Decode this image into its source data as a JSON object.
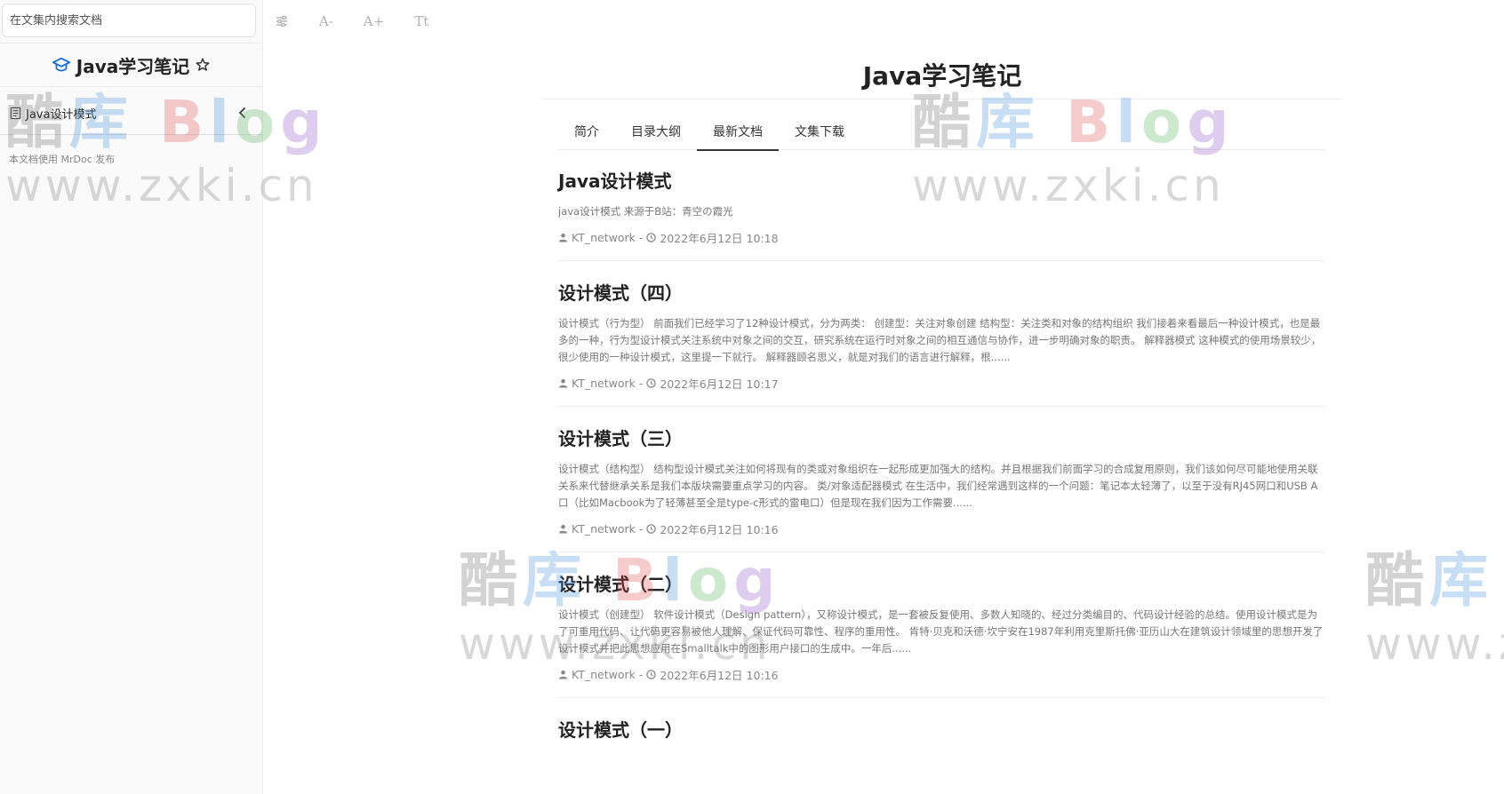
{
  "search": {
    "placeholder": "在文集内搜索文档"
  },
  "sidebar": {
    "title": "Java学习笔记",
    "items": [
      {
        "label": "Java设计模式"
      }
    ],
    "footer": "本文档使用 MrDoc 发布"
  },
  "toolbar": {
    "font_decrease": "A-",
    "font_increase": "A+",
    "typeface": "Tt"
  },
  "main": {
    "title": "Java学习笔记",
    "tabs": [
      {
        "label": "简介"
      },
      {
        "label": "目录大纲"
      },
      {
        "label": "最新文档",
        "active": true
      },
      {
        "label": "文集下载"
      }
    ],
    "articles": [
      {
        "title": "Java设计模式",
        "summary": "java设计模式 来源于B站：青空の霞光",
        "author": "KT_network",
        "separator": "-",
        "date": "2022年6月12日 10:18"
      },
      {
        "title": "设计模式（四）",
        "summary": "设计模式（行为型） 前面我们已经学习了12种设计模式，分为两类： 创建型：关注对象创建 结构型：关注类和对象的结构组织 我们接着来看最后一种设计模式，也是最多的一种，行为型设计模式关注系统中对象之间的交互，研究系统在运行时对象之间的相互通信与协作，进一步明确对象的职责。 解释器模式 这种模式的使用场景较少，很少使用的一种设计模式，这里提一下就行。 解释器顾名思义，就是对我们的语言进行解释，根......",
        "author": "KT_network",
        "separator": "-",
        "date": "2022年6月12日 10:17"
      },
      {
        "title": "设计模式（三）",
        "summary": "设计模式（结构型） 结构型设计模式关注如何将现有的类或对象组织在一起形成更加强大的结构。并且根据我们前面学习的合成复用原则，我们该如何尽可能地使用关联关系来代替继承关系是我们本版块需要重点学习的内容。 类/对象适配器模式 在生活中，我们经常遇到这样的一个问题：笔记本太轻薄了，以至于没有RJ45网口和USB A口（比如Macbook为了轻薄甚至全是type-c形式的雷电口）但是现在我们因为工作需要......",
        "author": "KT_network",
        "separator": "-",
        "date": "2022年6月12日 10:16"
      },
      {
        "title": "设计模式（二）",
        "summary": "设计模式（创建型） 软件设计模式（Design pattern），又称设计模式，是一套被反复使用、多数人知晓的、经过分类编目的、代码设计经验的总结。使用设计模式是为了可重用代码、让代码更容易被他人理解、保证代码可靠性、程序的重用性。 肯特·贝克和沃德·坎宁安在1987年利用克里斯托佛·亚历山大在建筑设计领域里的思想开发了设计模式并把此思想应用在Smalltalk中的图形用户接口的生成中。一年后......",
        "author": "KT_network",
        "separator": "-",
        "date": "2022年6月12日 10:16"
      },
      {
        "title": "设计模式（一）"
      }
    ]
  },
  "watermark": {
    "logo_chars": [
      "酷",
      "库",
      "B",
      "l",
      "o",
      "g"
    ],
    "url": "www.zxki.cn"
  },
  "colors": {
    "accent_icon": "#1e6fd9",
    "text_primary": "#222222",
    "text_muted": "#888888"
  }
}
